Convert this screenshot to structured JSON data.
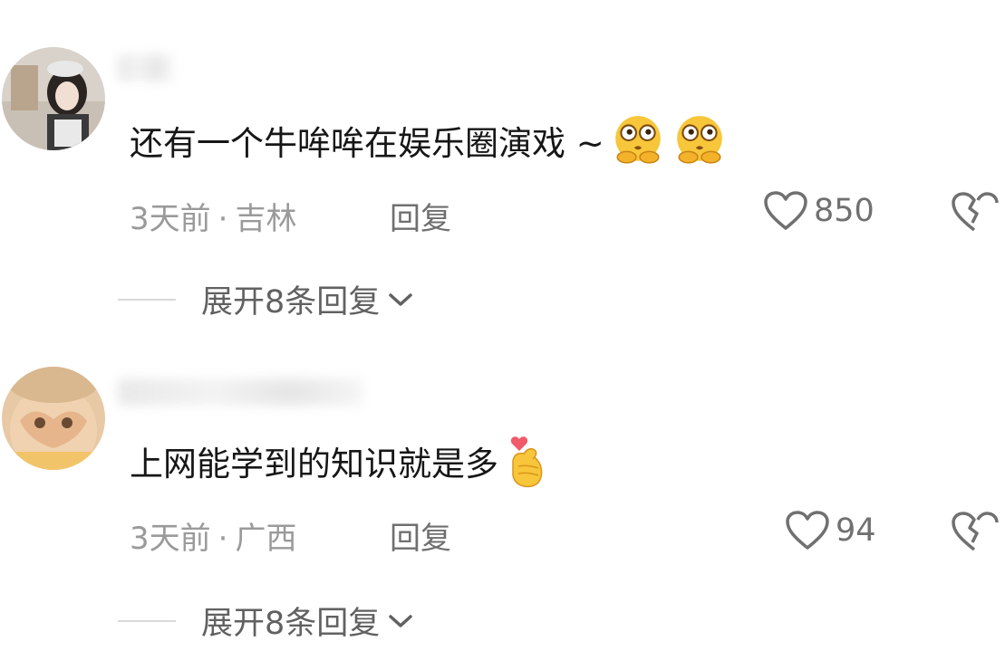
{
  "comments": [
    {
      "text": "还有一个牛哞哞在娱乐圈演戏 ~",
      "emoji": "face-with-hands-emoji",
      "emoji_count": 2,
      "time": "3天前",
      "location": "吉林",
      "reply_label": "回复",
      "likes": "850",
      "expand_label": "展开8条回复"
    },
    {
      "text": "上网能学到的知识就是多",
      "emoji": "finger-heart-emoji",
      "emoji_count": 1,
      "time": "3天前",
      "location": "广西",
      "reply_label": "回复",
      "likes": "94",
      "expand_label": "展开8条回复"
    }
  ],
  "separator": "·",
  "colors": {
    "text": "#161616",
    "meta": "#9a9a9a",
    "icon": "#707070",
    "emoji": "#f7c63a"
  },
  "icons": [
    "heart-outline-icon",
    "broken-heart-icon",
    "chevron-down-icon"
  ]
}
